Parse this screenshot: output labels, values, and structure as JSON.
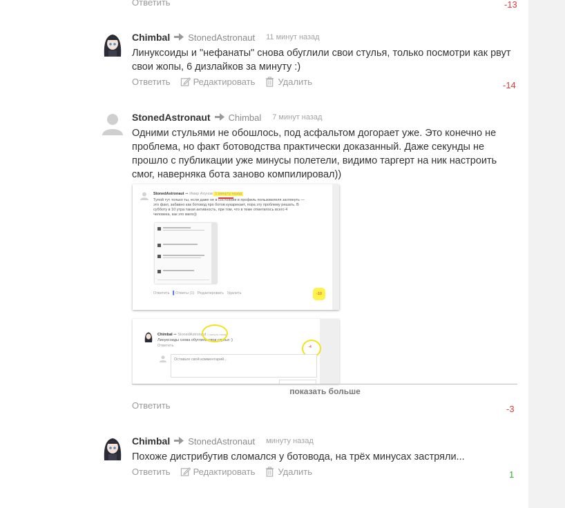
{
  "colors": {
    "negative": "#e03b3b",
    "positive": "#3aa83a",
    "highlight": "#fff34a"
  },
  "top_reply": {
    "reply": "Ответить",
    "score": "-13"
  },
  "comments": [
    {
      "author": "Chimbal",
      "reply_to": "StonedAstronaut",
      "time": "11 минут назад",
      "text": "Линуксоиды и \"нефанаты\" снова обуглили свои стулья, только посмотри как рвут свои жопы, 6 дизлайков за минуту :)",
      "actions": {
        "reply": "Ответить",
        "edit": "Редактировать",
        "delete": "Удалить"
      },
      "score": "-14"
    },
    {
      "author": "StonedAstronaut",
      "reply_to": "Chimbal",
      "time": "7 минут назад",
      "text": "Одними стульями не обошлось, под асфальтом догорает уже. Это конечно не проблема, но факт ботоводства практически доказанный. Даже секунды не прошло с публикации уже минусы полетели, видимо таргерт на ник настроить смог, наверняка бота заново компилировал))",
      "actions": {
        "reply": "Ответить"
      },
      "score": "-3"
    },
    {
      "author": "Chimbal",
      "reply_to": "StonedAstronaut",
      "time": "минуту назад",
      "text": "Похоже дистрибутив сломался у ботовода, на трёх минусах застряли...",
      "actions": {
        "reply": "Ответить",
        "edit": "Редактировать",
        "delete": "Удалить"
      },
      "score": "1"
    }
  ],
  "screenshot1": {
    "author": "StonedAstronaut",
    "reply_to": "Имир Ахунов",
    "time": "1 минуту назад",
    "text_lines": [
      "Тупой тут только ты, если даже не в состоянии в профиль пользователя заглянуть —",
      "это факт, забавно как ботовод про ботов кукарекает, пора эту проблему решать. В",
      "субботу в 10 утра такая активность, при том, что в теме отметилось всего 4",
      "человека, как это мило))"
    ],
    "actions": [
      "Ответить",
      "Ответы (1)",
      "Редактировать",
      "Удалить"
    ],
    "score": "-10"
  },
  "screenshot2": {
    "author": "Chimbal",
    "reply_to": "StonedAstronaut",
    "time": "1 минуту назад",
    "text": "Линуксоиды снова обуглили свои стулья :)",
    "reply": "Ответить",
    "score": "-4",
    "input_placeholder": "Оставьте свой комментарий..."
  },
  "show_more": "показать больше"
}
